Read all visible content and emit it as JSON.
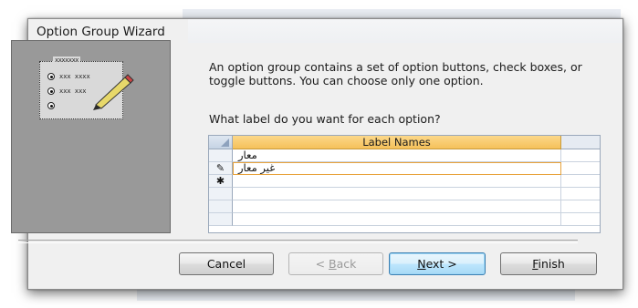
{
  "dialog": {
    "title": "Option Group Wizard"
  },
  "illustration": {
    "frame_title": "xxxxxxx",
    "rows": [
      "xxx xxxx",
      "xxx xxx",
      ""
    ],
    "pencil_icon": "pencil-icon"
  },
  "intro_text": "An option group contains a set of option buttons, check boxes, or toggle buttons. You can choose only one option.",
  "question_text": "What label do you want for each option?",
  "grid": {
    "column_header": "Label Names",
    "rows": [
      {
        "selector": "",
        "value": "معار"
      },
      {
        "selector": "✎",
        "value": "غير معار"
      },
      {
        "selector": "✱",
        "value": ""
      },
      {
        "selector": "",
        "value": ""
      },
      {
        "selector": "",
        "value": ""
      },
      {
        "selector": "",
        "value": ""
      }
    ]
  },
  "buttons": {
    "cancel": "Cancel",
    "back_prefix": "< ",
    "back_mnemonic": "B",
    "back_rest": "ack",
    "next_mnemonic": "N",
    "next_rest": "ext >",
    "finish_mnemonic": "F",
    "finish_rest": "inish"
  },
  "colors": {
    "header_accent": "#f5c15a",
    "active_row_border": "#e8a33c",
    "default_button": "#3c7fb1"
  }
}
